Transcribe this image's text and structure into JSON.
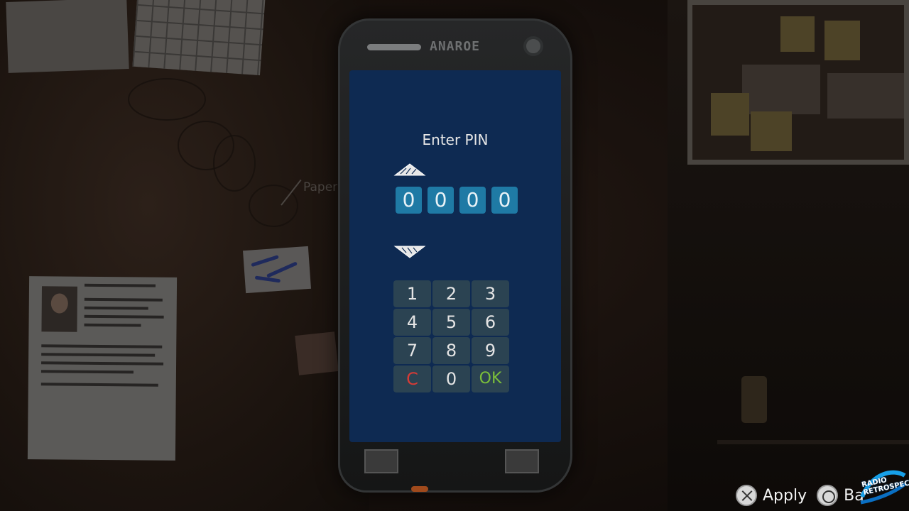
{
  "scene": {
    "paper_label": "Paper"
  },
  "phone": {
    "brand": "ANAROE",
    "screen_title": "Enter PIN",
    "pin_digits": [
      "0",
      "0",
      "0",
      "0"
    ],
    "keypad": [
      "1",
      "2",
      "3",
      "4",
      "5",
      "6",
      "7",
      "8",
      "9",
      "C",
      "0",
      "OK"
    ],
    "colors": {
      "screen_bg": "#0e2a52",
      "digit_bg": "#1f7aa5",
      "key_bg": "#2b4352",
      "clear_key": "#d63b36",
      "ok_key": "#7bbf3a"
    }
  },
  "prompts": {
    "apply_icon": "cross-button-icon",
    "apply_label": "Apply",
    "back_icon": "circle-button-icon",
    "back_label": "Ba"
  },
  "watermark": {
    "text": "RADIO RETROSPECT"
  }
}
